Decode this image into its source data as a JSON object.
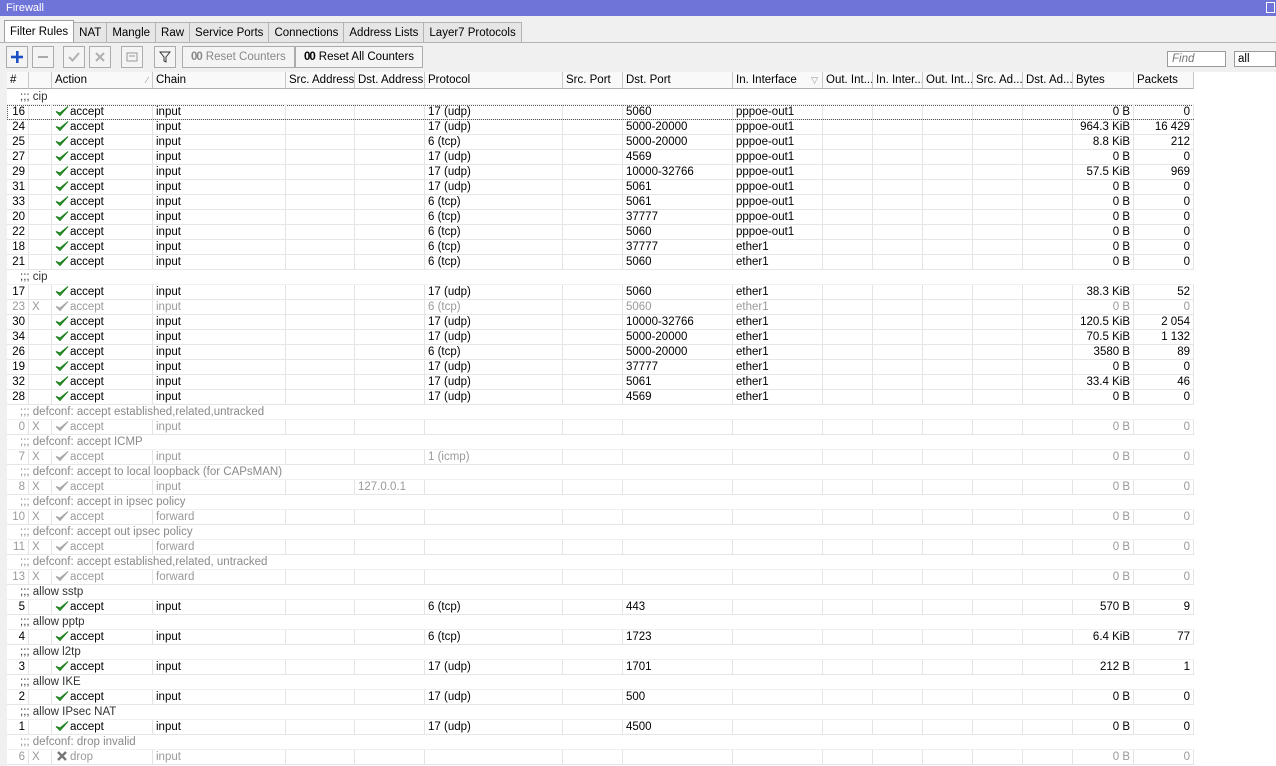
{
  "window": {
    "title": "Firewall"
  },
  "tabs": [
    "Filter Rules",
    "NAT",
    "Mangle",
    "Raw",
    "Service Ports",
    "Connections",
    "Address Lists",
    "Layer7 Protocols"
  ],
  "active_tab": "Filter Rules",
  "toolbar": {
    "add_icon": "plus-icon",
    "remove_icon": "minus-icon",
    "enable_icon": "check-icon",
    "disable_icon": "x-icon",
    "comment_icon": "note-icon",
    "filter_icon": "funnel-icon",
    "reset_counters_prefix": "00",
    "reset_counters_label": "Reset Counters",
    "reset_all_counters_prefix": "00",
    "reset_all_counters_label": "Reset All Counters"
  },
  "search": {
    "placeholder": "Find",
    "filter_value": "all"
  },
  "columns": [
    "#",
    "",
    "Action",
    "Chain",
    "Src. Address",
    "Dst. Address",
    "Protocol",
    "Src. Port",
    "Dst. Port",
    "In. Interface",
    "Out. Int...",
    "In. Inter...",
    "Out. Int...",
    "Src. Ad...",
    "Dst. Ad...",
    "Bytes",
    "Packets"
  ],
  "colors": {
    "titlebar": "#6e74d8",
    "accept_check": "#2a9a2a",
    "disabled_text": "#9a9a9a",
    "drop_icon": "#777777"
  },
  "rows": [
    {
      "type": "comment",
      "text": ";;; cip"
    },
    {
      "type": "rule",
      "id": "16",
      "flag": "",
      "action": "accept",
      "chain": "input",
      "dst": "",
      "protocol": "17 (udp)",
      "dst_port": "5060",
      "in_iface": "pppoe-out1",
      "bytes": "0 B",
      "packets": "0",
      "selected": true
    },
    {
      "type": "rule",
      "id": "24",
      "flag": "",
      "action": "accept",
      "chain": "input",
      "dst": "",
      "protocol": "17 (udp)",
      "dst_port": "5000-20000",
      "in_iface": "pppoe-out1",
      "bytes": "964.3 KiB",
      "packets": "16 429"
    },
    {
      "type": "rule",
      "id": "25",
      "flag": "",
      "action": "accept",
      "chain": "input",
      "dst": "",
      "protocol": "6 (tcp)",
      "dst_port": "5000-20000",
      "in_iface": "pppoe-out1",
      "bytes": "8.8 KiB",
      "packets": "212"
    },
    {
      "type": "rule",
      "id": "27",
      "flag": "",
      "action": "accept",
      "chain": "input",
      "dst": "",
      "protocol": "17 (udp)",
      "dst_port": "4569",
      "in_iface": "pppoe-out1",
      "bytes": "0 B",
      "packets": "0"
    },
    {
      "type": "rule",
      "id": "29",
      "flag": "",
      "action": "accept",
      "chain": "input",
      "dst": "",
      "protocol": "17 (udp)",
      "dst_port": "10000-32766",
      "in_iface": "pppoe-out1",
      "bytes": "57.5 KiB",
      "packets": "969"
    },
    {
      "type": "rule",
      "id": "31",
      "flag": "",
      "action": "accept",
      "chain": "input",
      "dst": "",
      "protocol": "17 (udp)",
      "dst_port": "5061",
      "in_iface": "pppoe-out1",
      "bytes": "0 B",
      "packets": "0"
    },
    {
      "type": "rule",
      "id": "33",
      "flag": "",
      "action": "accept",
      "chain": "input",
      "dst": "",
      "protocol": "6 (tcp)",
      "dst_port": "5061",
      "in_iface": "pppoe-out1",
      "bytes": "0 B",
      "packets": "0"
    },
    {
      "type": "rule",
      "id": "20",
      "flag": "",
      "action": "accept",
      "chain": "input",
      "dst": "",
      "protocol": "6 (tcp)",
      "dst_port": "37777",
      "in_iface": "pppoe-out1",
      "bytes": "0 B",
      "packets": "0"
    },
    {
      "type": "rule",
      "id": "22",
      "flag": "",
      "action": "accept",
      "chain": "input",
      "dst": "",
      "protocol": "6 (tcp)",
      "dst_port": "5060",
      "in_iface": "pppoe-out1",
      "bytes": "0 B",
      "packets": "0"
    },
    {
      "type": "rule",
      "id": "18",
      "flag": "",
      "action": "accept",
      "chain": "input",
      "dst": "",
      "protocol": "6 (tcp)",
      "dst_port": "37777",
      "in_iface": "ether1",
      "bytes": "0 B",
      "packets": "0"
    },
    {
      "type": "rule",
      "id": "21",
      "flag": "",
      "action": "accept",
      "chain": "input",
      "dst": "",
      "protocol": "6 (tcp)",
      "dst_port": "5060",
      "in_iface": "ether1",
      "bytes": "0 B",
      "packets": "0"
    },
    {
      "type": "comment",
      "text": ";;; cip"
    },
    {
      "type": "rule",
      "id": "17",
      "flag": "",
      "action": "accept",
      "chain": "input",
      "dst": "",
      "protocol": "17 (udp)",
      "dst_port": "5060",
      "in_iface": "ether1",
      "bytes": "38.3 KiB",
      "packets": "52"
    },
    {
      "type": "rule",
      "id": "23",
      "flag": "X",
      "action": "accept",
      "chain": "input",
      "dst": "",
      "protocol": "6 (tcp)",
      "dst_port": "5060",
      "in_iface": "ether1",
      "bytes": "0 B",
      "packets": "0"
    },
    {
      "type": "rule",
      "id": "30",
      "flag": "",
      "action": "accept",
      "chain": "input",
      "dst": "",
      "protocol": "17 (udp)",
      "dst_port": "10000-32766",
      "in_iface": "ether1",
      "bytes": "120.5 KiB",
      "packets": "2 054"
    },
    {
      "type": "rule",
      "id": "34",
      "flag": "",
      "action": "accept",
      "chain": "input",
      "dst": "",
      "protocol": "17 (udp)",
      "dst_port": "5000-20000",
      "in_iface": "ether1",
      "bytes": "70.5 KiB",
      "packets": "1 132"
    },
    {
      "type": "rule",
      "id": "26",
      "flag": "",
      "action": "accept",
      "chain": "input",
      "dst": "",
      "protocol": "6 (tcp)",
      "dst_port": "5000-20000",
      "in_iface": "ether1",
      "bytes": "3580 B",
      "packets": "89"
    },
    {
      "type": "rule",
      "id": "19",
      "flag": "",
      "action": "accept",
      "chain": "input",
      "dst": "",
      "protocol": "17 (udp)",
      "dst_port": "37777",
      "in_iface": "ether1",
      "bytes": "0 B",
      "packets": "0"
    },
    {
      "type": "rule",
      "id": "32",
      "flag": "",
      "action": "accept",
      "chain": "input",
      "dst": "",
      "protocol": "17 (udp)",
      "dst_port": "5061",
      "in_iface": "ether1",
      "bytes": "33.4 KiB",
      "packets": "46"
    },
    {
      "type": "rule",
      "id": "28",
      "flag": "",
      "action": "accept",
      "chain": "input",
      "dst": "",
      "protocol": "17 (udp)",
      "dst_port": "4569",
      "in_iface": "ether1",
      "bytes": "0 B",
      "packets": "0"
    },
    {
      "type": "comment",
      "text": ";;; defconf: accept established,related,untracked",
      "dim": true
    },
    {
      "type": "rule",
      "id": "0",
      "flag": "X",
      "action": "accept",
      "chain": "input",
      "dst": "",
      "protocol": "",
      "dst_port": "",
      "in_iface": "",
      "bytes": "0 B",
      "packets": "0"
    },
    {
      "type": "comment",
      "text": ";;; defconf: accept ICMP",
      "dim": true
    },
    {
      "type": "rule",
      "id": "7",
      "flag": "X",
      "action": "accept",
      "chain": "input",
      "dst": "",
      "protocol": "1 (icmp)",
      "dst_port": "",
      "in_iface": "",
      "bytes": "0 B",
      "packets": "0"
    },
    {
      "type": "comment",
      "text": ";;; defconf: accept to local loopback (for CAPsMAN)",
      "dim": true
    },
    {
      "type": "rule",
      "id": "8",
      "flag": "X",
      "action": "accept",
      "chain": "input",
      "dst": "127.0.0.1",
      "protocol": "",
      "dst_port": "",
      "in_iface": "",
      "bytes": "0 B",
      "packets": "0"
    },
    {
      "type": "comment",
      "text": ";;; defconf: accept in ipsec policy",
      "dim": true
    },
    {
      "type": "rule",
      "id": "10",
      "flag": "X",
      "action": "accept",
      "chain": "forward",
      "dst": "",
      "protocol": "",
      "dst_port": "",
      "in_iface": "",
      "bytes": "0 B",
      "packets": "0"
    },
    {
      "type": "comment",
      "text": ";;; defconf: accept out ipsec policy",
      "dim": true
    },
    {
      "type": "rule",
      "id": "11",
      "flag": "X",
      "action": "accept",
      "chain": "forward",
      "dst": "",
      "protocol": "",
      "dst_port": "",
      "in_iface": "",
      "bytes": "0 B",
      "packets": "0"
    },
    {
      "type": "comment",
      "text": ";;; defconf: accept established,related, untracked",
      "dim": true
    },
    {
      "type": "rule",
      "id": "13",
      "flag": "X",
      "action": "accept",
      "chain": "forward",
      "dst": "",
      "protocol": "",
      "dst_port": "",
      "in_iface": "",
      "bytes": "0 B",
      "packets": "0"
    },
    {
      "type": "comment",
      "text": ";;; allow sstp"
    },
    {
      "type": "rule",
      "id": "5",
      "flag": "",
      "action": "accept",
      "chain": "input",
      "dst": "",
      "protocol": "6 (tcp)",
      "dst_port": "443",
      "in_iface": "",
      "bytes": "570 B",
      "packets": "9"
    },
    {
      "type": "comment",
      "text": ";;; allow pptp"
    },
    {
      "type": "rule",
      "id": "4",
      "flag": "",
      "action": "accept",
      "chain": "input",
      "dst": "",
      "protocol": "6 (tcp)",
      "dst_port": "1723",
      "in_iface": "",
      "bytes": "6.4 KiB",
      "packets": "77"
    },
    {
      "type": "comment",
      "text": ";;; allow l2tp"
    },
    {
      "type": "rule",
      "id": "3",
      "flag": "",
      "action": "accept",
      "chain": "input",
      "dst": "",
      "protocol": "17 (udp)",
      "dst_port": "1701",
      "in_iface": "",
      "bytes": "212 B",
      "packets": "1"
    },
    {
      "type": "comment",
      "text": ";;; allow IKE"
    },
    {
      "type": "rule",
      "id": "2",
      "flag": "",
      "action": "accept",
      "chain": "input",
      "dst": "",
      "protocol": "17 (udp)",
      "dst_port": "500",
      "in_iface": "",
      "bytes": "0 B",
      "packets": "0"
    },
    {
      "type": "comment",
      "text": ";;; allow IPsec NAT"
    },
    {
      "type": "rule",
      "id": "1",
      "flag": "",
      "action": "accept",
      "chain": "input",
      "dst": "",
      "protocol": "17 (udp)",
      "dst_port": "4500",
      "in_iface": "",
      "bytes": "0 B",
      "packets": "0"
    },
    {
      "type": "comment",
      "text": ";;; defconf: drop invalid",
      "dim": true
    },
    {
      "type": "rule",
      "id": "6",
      "flag": "X",
      "action": "drop",
      "chain": "input",
      "dst": "",
      "protocol": "",
      "dst_port": "",
      "in_iface": "",
      "bytes": "0 B",
      "packets": "0"
    }
  ]
}
